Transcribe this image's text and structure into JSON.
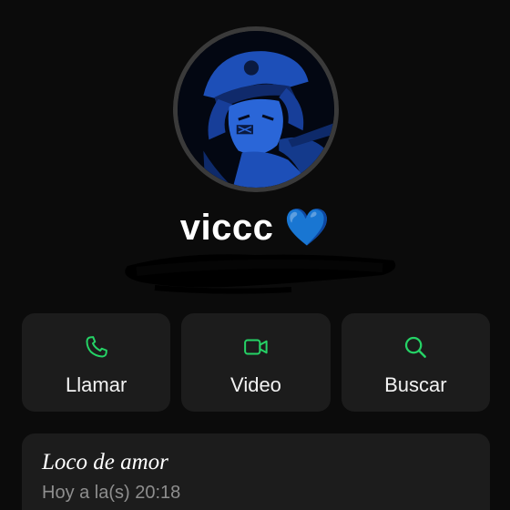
{
  "contact": {
    "name": "viccc 💙"
  },
  "actions": [
    {
      "label": "Llamar",
      "icon": "phone-icon"
    },
    {
      "label": "Video",
      "icon": "video-camera-icon"
    },
    {
      "label": "Buscar",
      "icon": "search-icon"
    }
  ],
  "status": {
    "text": "Loco de amor",
    "time": "Hoy a la(s) 20:18"
  },
  "colors": {
    "background": "#0b0b0b",
    "card": "#1c1c1c",
    "accent": "#25d366",
    "muted_text": "#8e8e8e"
  }
}
